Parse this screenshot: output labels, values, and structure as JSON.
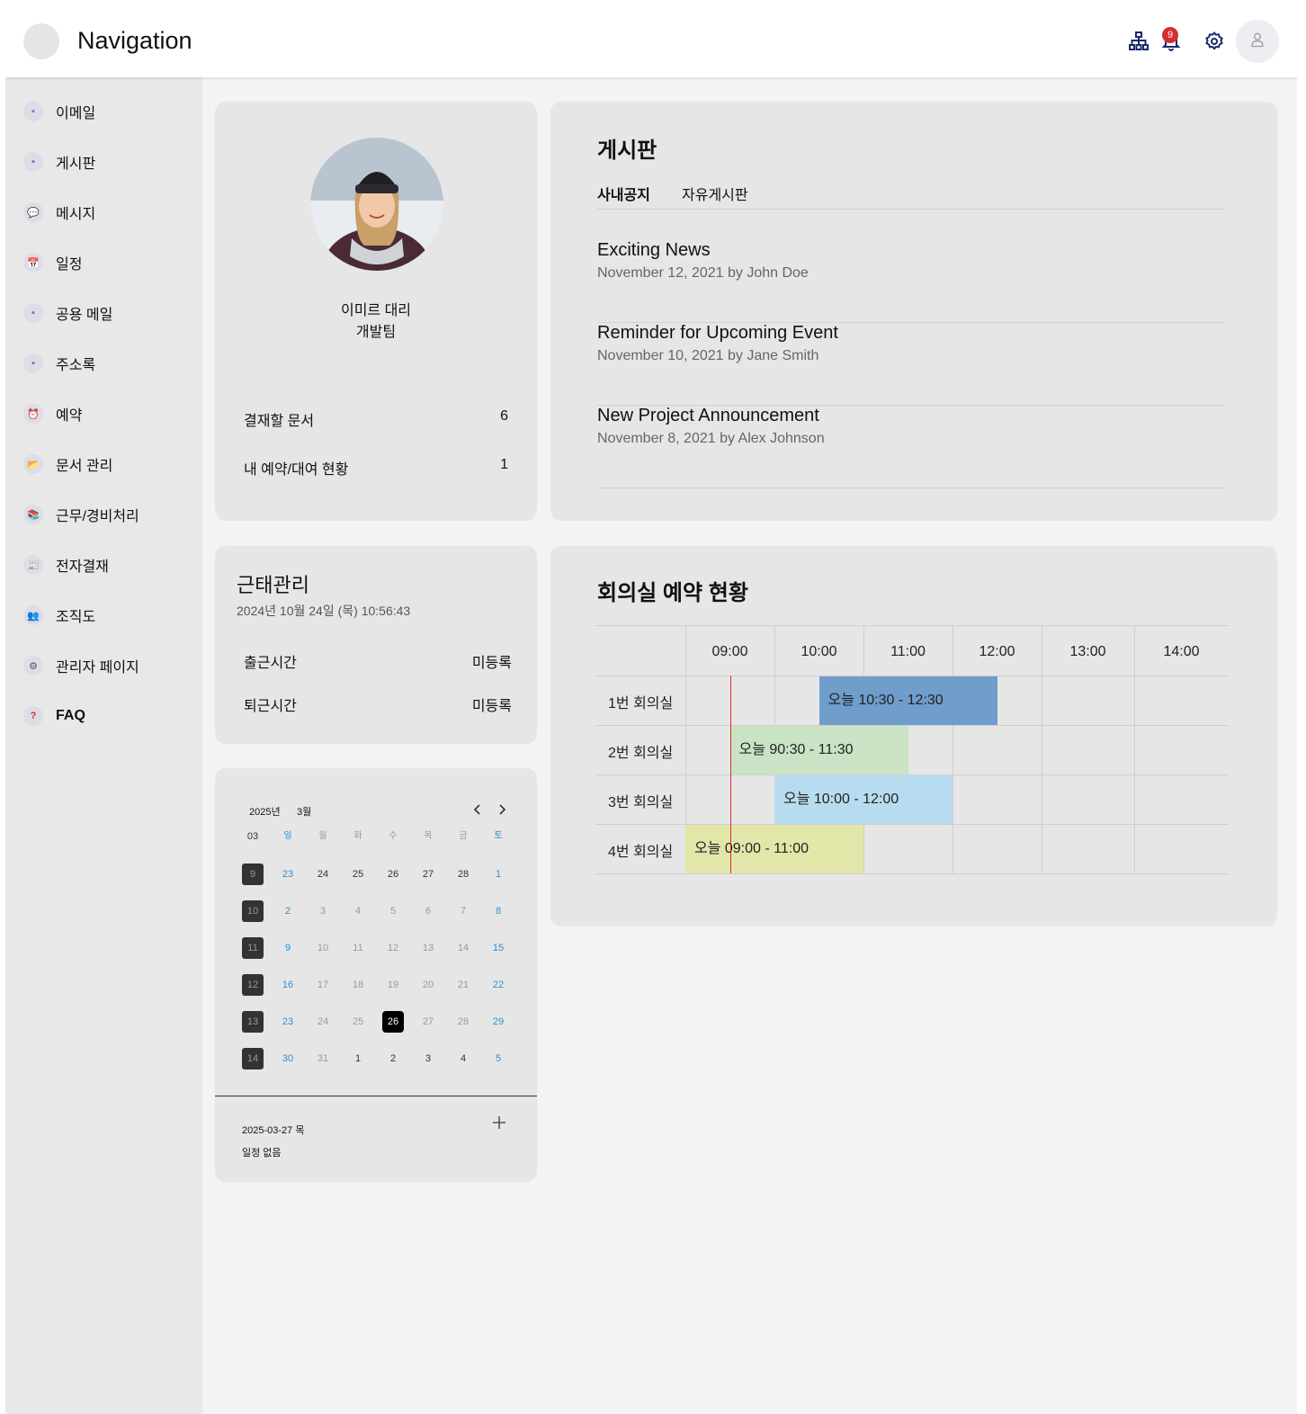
{
  "app": {
    "title": "Navigation",
    "notification_count": "9"
  },
  "topbar_icons": [
    "org-chart-icon",
    "bell-icon",
    "gear-icon",
    "user-icon"
  ],
  "colors": {
    "accent": "#1b2a6b",
    "badge": "#d32f2f",
    "weekend": "#2b8fd6",
    "now_line": "#d32f2f"
  },
  "sidebar": {
    "items": [
      {
        "label": "이메일",
        "icon": "mail-icon",
        "glyph": "▪"
      },
      {
        "label": "게시판",
        "icon": "board-icon",
        "glyph": "▪"
      },
      {
        "label": "메시지",
        "icon": "message-icon",
        "glyph": "💬"
      },
      {
        "label": "일정",
        "icon": "calendar-icon",
        "glyph": "📅"
      },
      {
        "label": "공용 메일",
        "icon": "shared-mail-icon",
        "glyph": "▪"
      },
      {
        "label": "주소록",
        "icon": "address-book-icon",
        "glyph": "▪"
      },
      {
        "label": "예약",
        "icon": "alarm-clock-icon",
        "glyph": "⏰"
      },
      {
        "label": "문서 관리",
        "icon": "folder-icon",
        "glyph": "📂"
      },
      {
        "label": "근무/경비처리",
        "icon": "books-icon",
        "glyph": "📚"
      },
      {
        "label": "전자결재",
        "icon": "newspaper-icon",
        "glyph": "📰"
      },
      {
        "label": "조직도",
        "icon": "people-icon",
        "glyph": "👥"
      },
      {
        "label": "관리자 페이지",
        "icon": "settings-icon",
        "glyph": "⚙"
      },
      {
        "label": "FAQ",
        "icon": "question-icon",
        "glyph": "?"
      }
    ]
  },
  "profile": {
    "name": "이미르 대리",
    "team": "개발팀",
    "stats": [
      {
        "label": "결재할 문서",
        "value": "6"
      },
      {
        "label": "내 예약/대여 현황",
        "value": "1"
      }
    ]
  },
  "board": {
    "title": "게시판",
    "tabs": [
      "사내공지",
      "자유게시판"
    ],
    "active_tab": "사내공지",
    "posts": [
      {
        "title": "Exciting News",
        "meta": "November 12, 2021 by John Doe"
      },
      {
        "title": "Reminder for Upcoming Event",
        "meta": "November 10, 2021 by Jane Smith"
      },
      {
        "title": "New Project Announcement",
        "meta": "November 8, 2021 by Alex Johnson"
      }
    ]
  },
  "attendance": {
    "title": "근태관리",
    "datetime": "2024년 10월 24일 (목) 10:56:43",
    "rows": [
      {
        "label": "출근시간",
        "value": "미등록"
      },
      {
        "label": "퇴근시간",
        "value": "미등록"
      }
    ]
  },
  "calendar": {
    "year_label": "2025년",
    "month_label": "3월",
    "week_col_header": "03",
    "weekdays": [
      "일",
      "월",
      "화",
      "수",
      "목",
      "금",
      "토"
    ],
    "weeks": [
      {
        "week": "9",
        "days": [
          "23",
          "24",
          "25",
          "26",
          "27",
          "28",
          "1"
        ]
      },
      {
        "week": "10",
        "days": [
          "2",
          "3",
          "4",
          "5",
          "6",
          "7",
          "8"
        ]
      },
      {
        "week": "11",
        "days": [
          "9",
          "10",
          "11",
          "12",
          "13",
          "14",
          "15"
        ]
      },
      {
        "week": "12",
        "days": [
          "16",
          "17",
          "18",
          "19",
          "20",
          "21",
          "22"
        ]
      },
      {
        "week": "13",
        "days": [
          "23",
          "24",
          "25",
          "26",
          "27",
          "28",
          "29"
        ]
      },
      {
        "week": "14",
        "days": [
          "30",
          "31",
          "1",
          "2",
          "3",
          "4",
          "5"
        ]
      }
    ],
    "today": "26",
    "selected_date": "2025-03-27 목",
    "no_events": "일정 없음"
  },
  "meeting_rooms": {
    "title": "회의실 예약 현황",
    "times": [
      "09:00",
      "10:00",
      "11:00",
      "12:00",
      "13:00",
      "14:00"
    ],
    "rooms": [
      "1번 회의실",
      "2번 회의실",
      "3번 회의실",
      "4번 회의실"
    ],
    "bookings": [
      {
        "room": "1번 회의실",
        "label": "오늘 10:30 - 12:30",
        "start": "10:30",
        "end": "12:30",
        "color": "#6f9dcc"
      },
      {
        "room": "2번 회의실",
        "label": "오늘 90:30 - 11:30",
        "start": "09:30",
        "end": "11:30",
        "color": "#c9e3c4"
      },
      {
        "room": "3번 회의실",
        "label": "오늘 10:00 - 12:00",
        "start": "10:00",
        "end": "12:00",
        "color": "#b7dcef"
      },
      {
        "room": "4번 회의실",
        "label": "오늘 09:00 - 11:00",
        "start": "09:00",
        "end": "11:00",
        "color": "#e2e6a8"
      }
    ],
    "now": "09:30"
  }
}
